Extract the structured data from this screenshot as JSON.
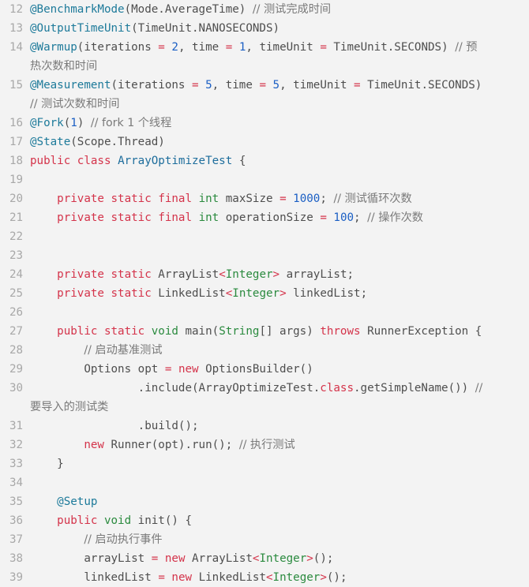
{
  "editor": {
    "language": "java",
    "colors": {
      "background": "#f3f3f3",
      "line_number": "#a8a8a8",
      "keyword": "#d4334a",
      "type": "#2a8a3e",
      "annotation": "#1d7a9a",
      "number": "#1b5fc4",
      "comment": "#7a7a7a",
      "plain": "#4e4e4e"
    },
    "lines": [
      {
        "n": "12",
        "tokens": [
          [
            "an",
            "@BenchmarkMode"
          ],
          [
            "p",
            "(Mode.AverageTime) "
          ],
          [
            "cm",
            "// 测试完成时间"
          ]
        ]
      },
      {
        "n": "13",
        "tokens": [
          [
            "an",
            "@OutputTimeUnit"
          ],
          [
            "p",
            "(TimeUnit.NANOSECONDS)"
          ]
        ]
      },
      {
        "n": "14",
        "tokens": [
          [
            "an",
            "@Warmup"
          ],
          [
            "p",
            "(iterations "
          ],
          [
            "op",
            "="
          ],
          [
            "p",
            " "
          ],
          [
            "num",
            "2"
          ],
          [
            "p",
            ", time "
          ],
          [
            "op",
            "="
          ],
          [
            "p",
            " "
          ],
          [
            "num",
            "1"
          ],
          [
            "p",
            ", timeUnit "
          ],
          [
            "op",
            "="
          ],
          [
            "p",
            " TimeUnit.SECONDS) "
          ],
          [
            "cm",
            "// 预"
          ]
        ],
        "wrap": "热次数和时间"
      },
      {
        "n": "15",
        "tokens": [
          [
            "an",
            "@Measurement"
          ],
          [
            "p",
            "(iterations "
          ],
          [
            "op",
            "="
          ],
          [
            "p",
            " "
          ],
          [
            "num",
            "5"
          ],
          [
            "p",
            ", time "
          ],
          [
            "op",
            "="
          ],
          [
            "p",
            " "
          ],
          [
            "num",
            "5"
          ],
          [
            "p",
            ", timeUnit "
          ],
          [
            "op",
            "="
          ],
          [
            "p",
            " TimeUnit.SECONDS)"
          ]
        ],
        "wrap": "// 测试次数和时间"
      },
      {
        "n": "16",
        "tokens": [
          [
            "an",
            "@Fork"
          ],
          [
            "p",
            "("
          ],
          [
            "num",
            "1"
          ],
          [
            "p",
            ") "
          ],
          [
            "cm",
            "// fork 1 个线程"
          ]
        ]
      },
      {
        "n": "17",
        "tokens": [
          [
            "an",
            "@State"
          ],
          [
            "p",
            "(Scope.Thread)"
          ]
        ]
      },
      {
        "n": "18",
        "tokens": [
          [
            "kw",
            "public"
          ],
          [
            "p",
            " "
          ],
          [
            "kw",
            "class"
          ],
          [
            "p",
            " "
          ],
          [
            "cls",
            "ArrayOptimizeTest"
          ],
          [
            "p",
            " {"
          ]
        ]
      },
      {
        "n": "19",
        "tokens": []
      },
      {
        "n": "20",
        "tokens": [
          [
            "p",
            "    "
          ],
          [
            "kw",
            "private"
          ],
          [
            "p",
            " "
          ],
          [
            "kw",
            "static"
          ],
          [
            "p",
            " "
          ],
          [
            "kw",
            "final"
          ],
          [
            "p",
            " "
          ],
          [
            "ty",
            "int"
          ],
          [
            "p",
            " maxSize "
          ],
          [
            "op",
            "="
          ],
          [
            "p",
            " "
          ],
          [
            "num",
            "1000"
          ],
          [
            "p",
            "; "
          ],
          [
            "cm",
            "// 测试循环次数"
          ]
        ]
      },
      {
        "n": "21",
        "tokens": [
          [
            "p",
            "    "
          ],
          [
            "kw",
            "private"
          ],
          [
            "p",
            " "
          ],
          [
            "kw",
            "static"
          ],
          [
            "p",
            " "
          ],
          [
            "kw",
            "final"
          ],
          [
            "p",
            " "
          ],
          [
            "ty",
            "int"
          ],
          [
            "p",
            " operationSize "
          ],
          [
            "op",
            "="
          ],
          [
            "p",
            " "
          ],
          [
            "num",
            "100"
          ],
          [
            "p",
            "; "
          ],
          [
            "cm",
            "// 操作次数"
          ]
        ]
      },
      {
        "n": "22",
        "tokens": []
      },
      {
        "n": "23",
        "tokens": []
      },
      {
        "n": "24",
        "tokens": [
          [
            "p",
            "    "
          ],
          [
            "kw",
            "private"
          ],
          [
            "p",
            " "
          ],
          [
            "kw",
            "static"
          ],
          [
            "p",
            " ArrayList"
          ],
          [
            "op",
            "<"
          ],
          [
            "ty",
            "Integer"
          ],
          [
            "op",
            ">"
          ],
          [
            "p",
            " arrayList;"
          ]
        ]
      },
      {
        "n": "25",
        "tokens": [
          [
            "p",
            "    "
          ],
          [
            "kw",
            "private"
          ],
          [
            "p",
            " "
          ],
          [
            "kw",
            "static"
          ],
          [
            "p",
            " LinkedList"
          ],
          [
            "op",
            "<"
          ],
          [
            "ty",
            "Integer"
          ],
          [
            "op",
            ">"
          ],
          [
            "p",
            " linkedList;"
          ]
        ]
      },
      {
        "n": "26",
        "tokens": []
      },
      {
        "n": "27",
        "tokens": [
          [
            "p",
            "    "
          ],
          [
            "kw",
            "public"
          ],
          [
            "p",
            " "
          ],
          [
            "kw",
            "static"
          ],
          [
            "p",
            " "
          ],
          [
            "ty",
            "void"
          ],
          [
            "p",
            " main("
          ],
          [
            "ty",
            "String"
          ],
          [
            "p",
            "[] args) "
          ],
          [
            "kw",
            "throws"
          ],
          [
            "p",
            " RunnerException {"
          ]
        ]
      },
      {
        "n": "28",
        "tokens": [
          [
            "p",
            "        "
          ],
          [
            "cm",
            "// 启动基准测试"
          ]
        ]
      },
      {
        "n": "29",
        "tokens": [
          [
            "p",
            "        Options opt "
          ],
          [
            "op",
            "="
          ],
          [
            "p",
            " "
          ],
          [
            "kw",
            "new"
          ],
          [
            "p",
            " OptionsBuilder()"
          ]
        ]
      },
      {
        "n": "30",
        "tokens": [
          [
            "p",
            "                .include(ArrayOptimizeTest."
          ],
          [
            "kw",
            "class"
          ],
          [
            "p",
            ".getSimpleName()) "
          ],
          [
            "cm",
            "//"
          ]
        ],
        "wrap": "要导入的测试类"
      },
      {
        "n": "31",
        "tokens": [
          [
            "p",
            "                .build();"
          ]
        ]
      },
      {
        "n": "32",
        "tokens": [
          [
            "p",
            "        "
          ],
          [
            "kw",
            "new"
          ],
          [
            "p",
            " Runner(opt).run(); "
          ],
          [
            "cm",
            "// 执行测试"
          ]
        ]
      },
      {
        "n": "33",
        "tokens": [
          [
            "p",
            "    }"
          ]
        ]
      },
      {
        "n": "34",
        "tokens": []
      },
      {
        "n": "35",
        "tokens": [
          [
            "p",
            "    "
          ],
          [
            "an",
            "@Setup"
          ]
        ]
      },
      {
        "n": "36",
        "tokens": [
          [
            "p",
            "    "
          ],
          [
            "kw",
            "public"
          ],
          [
            "p",
            " "
          ],
          [
            "ty",
            "void"
          ],
          [
            "p",
            " init() {"
          ]
        ]
      },
      {
        "n": "37",
        "tokens": [
          [
            "p",
            "        "
          ],
          [
            "cm",
            "// 启动执行事件"
          ]
        ]
      },
      {
        "n": "38",
        "tokens": [
          [
            "p",
            "        arrayList "
          ],
          [
            "op",
            "="
          ],
          [
            "p",
            " "
          ],
          [
            "kw",
            "new"
          ],
          [
            "p",
            " ArrayList"
          ],
          [
            "op",
            "<"
          ],
          [
            "ty",
            "Integer"
          ],
          [
            "op",
            ">"
          ],
          [
            "p",
            "();"
          ]
        ]
      },
      {
        "n": "39",
        "tokens": [
          [
            "p",
            "        linkedList "
          ],
          [
            "op",
            "="
          ],
          [
            "p",
            " "
          ],
          [
            "kw",
            "new"
          ],
          [
            "p",
            " LinkedList"
          ],
          [
            "op",
            "<"
          ],
          [
            "ty",
            "Integer"
          ],
          [
            "op",
            ">"
          ],
          [
            "p",
            "();"
          ]
        ]
      }
    ]
  }
}
